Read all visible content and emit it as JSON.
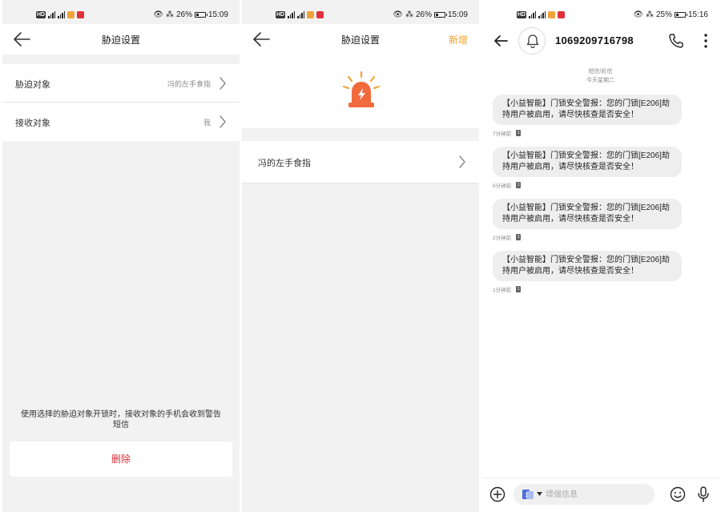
{
  "panel1": {
    "status": {
      "battery": "26%",
      "time": "15:09",
      "hd": "HD"
    },
    "title": "胁迫设置",
    "rows": [
      {
        "label": "胁迫对象",
        "value": "冯的左手食指"
      },
      {
        "label": "接收对象",
        "value": "我"
      }
    ],
    "note": "使用选择的胁迫对象开锁时，接收对象的手机会收到警告短信",
    "delete_label": "删除"
  },
  "panel2": {
    "status": {
      "battery": "26%",
      "time": "15:09",
      "hd": "HD"
    },
    "title": "胁迫设置",
    "add_label": "新增",
    "rows": [
      {
        "label": "冯的左手食指"
      }
    ],
    "colors": {
      "accent": "#f2a23a",
      "alarm": "#f06a3e"
    }
  },
  "panel3": {
    "status": {
      "battery": "25%",
      "time": "15:16",
      "hd": "HD"
    },
    "number": "1069209716798",
    "date_label": "短信/彩信",
    "date_day": "今天星期二",
    "messages": [
      {
        "text": "【小益智能】门锁安全警报：您的门锁[E206]劫持用户被启用，请尽快核查是否安全！",
        "time": "7分钟前"
      },
      {
        "text": "【小益智能】门锁安全警报：您的门锁[E206]劫持用户被启用，请尽快核查是否安全！",
        "time": "6分钟前"
      },
      {
        "text": "【小益智能】门锁安全警报：您的门锁[E206]劫持用户被启用，请尽快核查是否安全！",
        "time": "2分钟前"
      },
      {
        "text": "【小益智能】门锁安全警报：您的门锁[E206]劫持用户被启用，请尽快核查是否安全！",
        "time": "1分钟前"
      }
    ],
    "compose_placeholder": "增强信息",
    "sim_badge": "1"
  }
}
